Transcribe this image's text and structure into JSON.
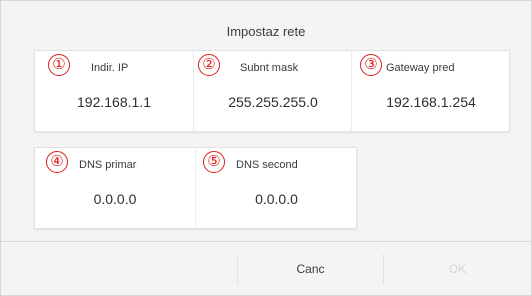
{
  "dialog": {
    "title": "Impostaz rete",
    "fields": [
      {
        "number": "①",
        "label": "Indir. IP",
        "value": "192.168.1.1"
      },
      {
        "number": "②",
        "label": "Subnt mask",
        "value": "255.255.255.0"
      },
      {
        "number": "③",
        "label": "Gateway pred",
        "value": "192.168.1.254"
      },
      {
        "number": "④",
        "label": "DNS primar",
        "value": "0.0.0.0"
      },
      {
        "number": "⑤",
        "label": "DNS second",
        "value": "0.0.0.0"
      }
    ],
    "buttons": {
      "cancel": "Canc",
      "ok": "OK"
    }
  },
  "colors": {
    "marker_red": "#e31b1b",
    "ok_disabled": "#d4d4d4"
  }
}
